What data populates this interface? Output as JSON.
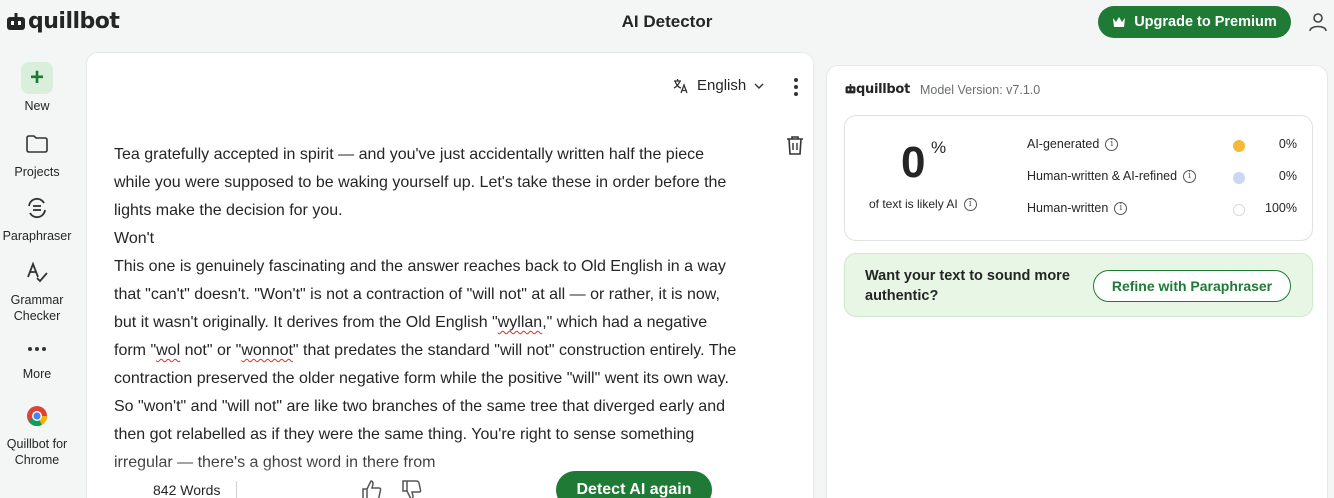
{
  "header": {
    "logo_text": "quillbot",
    "title": "AI Detector",
    "upgrade_label": "Upgrade to Premium"
  },
  "sidebar": {
    "items": [
      {
        "label": "New",
        "icon": "plus-icon"
      },
      {
        "label": "Projects",
        "icon": "folder-icon"
      },
      {
        "label": "Paraphraser",
        "icon": "paraphraser-icon"
      },
      {
        "label": "Grammar Checker",
        "icon": "grammar-icon"
      },
      {
        "label": "More",
        "icon": "more-dots-icon"
      },
      {
        "label": "Quillbot for Chrome",
        "icon": "chrome-icon"
      }
    ]
  },
  "editor": {
    "language": "English",
    "paragraphs": {
      "p1": "Tea gratefully accepted in spirit — and you've just accidentally written half the piece while you were supposed to be waking yourself up. Let's take these in order before the lights make the decision for you.",
      "p2": "Won't",
      "p3a": "This one is genuinely fascinating and the answer reaches back to Old English in a way that \"can't\" doesn't. \"Won't\" is not a contraction of \"will not\" at all — or rather, it is now, but it wasn't originally. It derives from the Old English \"",
      "p3_w1": "wyllan",
      "p3b": ",\" which had a negative form \"",
      "p3_w2": "wol",
      "p3c": " not\" or \"",
      "p3_w3": "wonnot",
      "p3d": "\" that predates the standard \"will not\" construction entirely. The contraction preserved the older negative form while the positive \"will\" went its own way. So \"won't\" and \"will not\" are like two branches of the same tree that diverged early and then got relabelled as if they were the same thing. You're right to sense something irregular — there's a ghost word in there from"
    },
    "word_count": "842 Words",
    "detect_label": "Detect AI again"
  },
  "panel": {
    "logo_text": "quillbot",
    "model_version": "Model Version: v7.1.0",
    "score": "0",
    "score_unit": "%",
    "score_caption": "of text is likely AI",
    "rows": [
      {
        "label": "AI-generated",
        "value": "0%",
        "color": "#f5b93a"
      },
      {
        "label": "Human-written & AI-refined",
        "value": "0%",
        "color": "#c9d8f5"
      },
      {
        "label": "Human-written",
        "value": "100%",
        "color": "#ffffff"
      }
    ],
    "cta_text": "Want your text to sound more authentic?",
    "refine_label": "Refine with Paraphraser"
  }
}
